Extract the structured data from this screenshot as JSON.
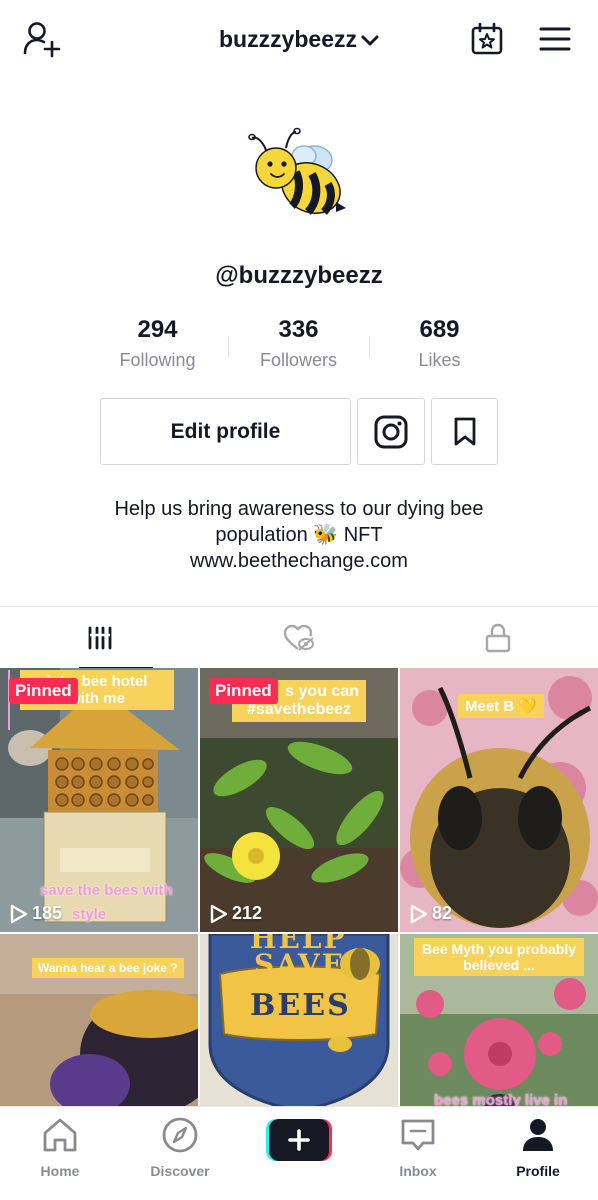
{
  "header": {
    "username_title": "buzzzybeezz",
    "icons": [
      "add-user-icon",
      "chevron-down-icon",
      "calendar-star-icon",
      "hamburger-menu-icon"
    ]
  },
  "profile": {
    "handle": "@buzzzybeezz",
    "stats": [
      {
        "value": "294",
        "label": "Following"
      },
      {
        "value": "336",
        "label": "Followers"
      },
      {
        "value": "689",
        "label": "Likes"
      }
    ],
    "edit_profile_label": "Edit profile",
    "bio_lines": [
      "Help us bring awareness to our dying bee",
      "population 🐝 NFT",
      "www.beethechange.com"
    ]
  },
  "tabs": [
    "grid-icon",
    "liked-hidden-icon",
    "lock-icon"
  ],
  "videos": [
    {
      "pinned_label": "Pinned",
      "caption": "...int a bee hotel with me",
      "caption_line1": "int a bee hotel",
      "caption_line2": "with me",
      "bottom_text": "save the bees with style",
      "bottom_line1": "save the bees with",
      "bottom_line2": "style",
      "views": "185"
    },
    {
      "pinned_label": "Pinned",
      "caption_line1": "s you can",
      "caption_line2": "#savethebeez",
      "views": "212"
    },
    {
      "caption_line1": "Meet B 💛",
      "views": "82"
    },
    {
      "caption_line1": "Wanna hear a bee joke ?"
    },
    {
      "poster_line1": "HELP",
      "poster_line2": "SAVE",
      "poster_line3": "BEES"
    },
    {
      "caption_line1": "Bee Myth you probably",
      "caption_line2": "believed ...",
      "bottom_text": "bees mostly live in"
    }
  ],
  "bottom_nav": [
    {
      "label": "Home",
      "icon": "home-icon"
    },
    {
      "label": "Discover",
      "icon": "compass-icon"
    },
    {
      "label": "",
      "icon": "create-plus-icon"
    },
    {
      "label": "Inbox",
      "icon": "inbox-icon"
    },
    {
      "label": "Profile",
      "icon": "profile-icon"
    }
  ],
  "colors": {
    "pinned": "#fe2c55",
    "caption_bg": "#f7d35b",
    "text_primary": "#161823",
    "text_secondary": "#8a8b91"
  }
}
